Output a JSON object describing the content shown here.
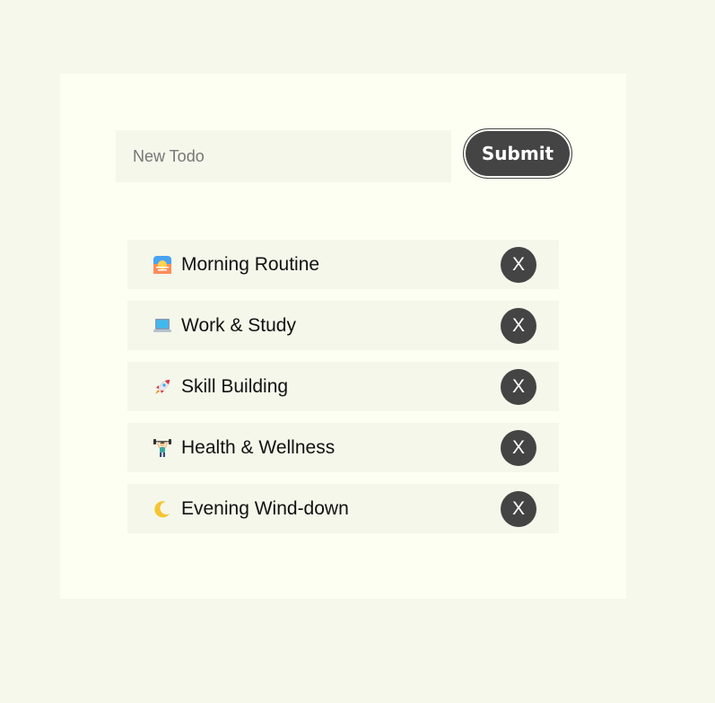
{
  "form": {
    "input_placeholder": "New Todo",
    "input_value": "",
    "submit_label": "Submit"
  },
  "todos": [
    {
      "icon": "sunrise-icon",
      "label": "Morning Routine",
      "delete_label": "X"
    },
    {
      "icon": "laptop-icon",
      "label": "Work & Study",
      "delete_label": "X"
    },
    {
      "icon": "rocket-icon",
      "label": "Skill Building",
      "delete_label": "X"
    },
    {
      "icon": "weightlifter-icon",
      "label": "Health & Wellness",
      "delete_label": "X"
    },
    {
      "icon": "crescent-moon-icon",
      "label": "Evening Wind-down",
      "delete_label": "X"
    }
  ],
  "colors": {
    "page_background": "#f5f8ea",
    "panel_background": "#fefff3",
    "item_background": "#f4f7ea",
    "button_dark": "#444444",
    "button_text": "#ffffff"
  }
}
